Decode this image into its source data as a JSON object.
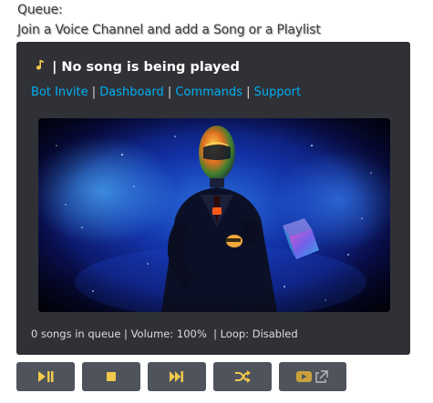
{
  "queue": {
    "title": "Queue:",
    "message": "Join a Voice Channel and add a Song or a Playlist"
  },
  "embed": {
    "title": "| No song is being played",
    "title_icon": "music-note-icon",
    "links": [
      {
        "label": "Bot Invite"
      },
      {
        "label": "Dashboard"
      },
      {
        "label": "Commands"
      },
      {
        "label": "Support"
      }
    ],
    "separator": " | ",
    "footer": "0 songs in queue | Volume: 100%  | Loop: Disabled"
  },
  "controls": [
    {
      "name": "play-pause-button",
      "icon": "play-pause-icon"
    },
    {
      "name": "stop-button",
      "icon": "stop-icon"
    },
    {
      "name": "skip-button",
      "icon": "skip-icon"
    },
    {
      "name": "shuffle-button",
      "icon": "shuffle-icon"
    },
    {
      "name": "youtube-link-button",
      "icon": "youtube-icon"
    }
  ],
  "colors": {
    "embed_bg": "#2f3136",
    "link": "#00aff4",
    "button_bg": "#4f545c",
    "icon": "#f2c94c",
    "text": "#dcddde"
  }
}
